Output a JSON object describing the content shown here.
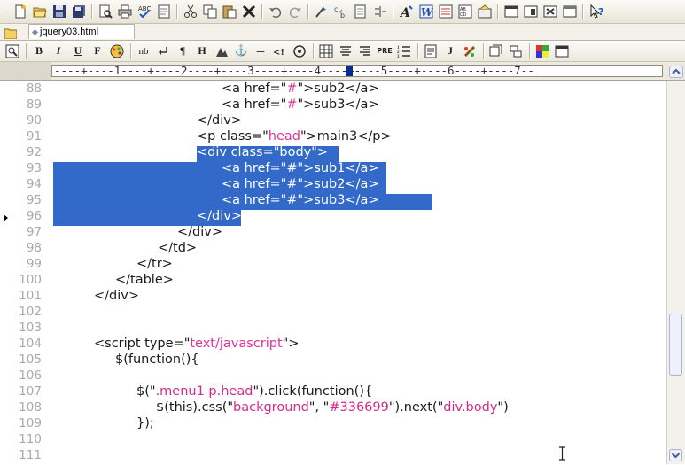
{
  "toolbar": {
    "buttons": [
      "new-file",
      "open-folder",
      "save",
      "save-all",
      "print-preview",
      "print",
      "spell-check",
      "page-setup",
      "cut",
      "copy",
      "paste",
      "delete",
      "undo",
      "redo",
      "find",
      "replace",
      "goto",
      "indent",
      "font",
      "html-wizard",
      "list",
      "insert-table",
      "settings",
      "view-normal",
      "view-split",
      "view-preview",
      "view-full",
      "help"
    ]
  },
  "tab": {
    "title": "jquery03.html"
  },
  "format_toolbar": {
    "buttons": [
      "B",
      "I",
      "U",
      "F",
      "nb",
      "¶",
      "H",
      "⚓",
      "═",
      "PRE",
      "J"
    ]
  },
  "ruler": {
    "text": "----+----1----+----2----+----3----+----4----+----5----+----6----+----7--"
  },
  "editor": {
    "line_numbers": [
      "88",
      "89",
      "90",
      "91",
      "92",
      "93",
      "94",
      "95",
      "96",
      "97",
      "98",
      "99",
      "100",
      "101",
      "102",
      "103",
      "104",
      "105",
      "106",
      "107",
      "108",
      "109",
      "110",
      "111"
    ],
    "lines": {
      "l88": {
        "a": "<a href=\"",
        "v": "#",
        "b": "\">sub2</a>"
      },
      "l89": {
        "a": "<a href=\"",
        "v": "#",
        "b": "\">sub3</a>"
      },
      "l90": {
        "t": "</div>"
      },
      "l91": {
        "a": "<p class=\"",
        "v": "head",
        "b": "\">main3</p>"
      },
      "l92": {
        "t": "<div class=\"body\">"
      },
      "l93": {
        "t": "<a href=\"#\">sub1</a>"
      },
      "l94": {
        "t": "<a href=\"#\">sub2</a>"
      },
      "l95": {
        "t": "<a href=\"#\">sub3</a>"
      },
      "l96": {
        "t": "</div>"
      },
      "l97": {
        "t": "</div>"
      },
      "l98": {
        "t": "</td>"
      },
      "l99": {
        "t": "</tr>"
      },
      "l100": {
        "t": "</table>"
      },
      "l101": {
        "t": "</div>"
      },
      "l104": {
        "a": "<script type=\"",
        "v": "text/javascript",
        "b": "\">"
      },
      "l105": {
        "t": "$(function(){"
      },
      "l107": {
        "a": "$(\"",
        "v": ".menu1 p.head",
        "b": "\").click(function(){"
      },
      "l108": {
        "a": "$(this).css(\"",
        "v": "background",
        "m": "\", \"",
        "v2": "#336699",
        "m2": "\").next(\"",
        "v3": "div.body",
        "b": "\")"
      },
      "l109": {
        "t": "});"
      }
    }
  },
  "colors": {
    "selection": "#3369c8",
    "attribute_value": "#e0309a",
    "line_number": "#a9a9a9"
  }
}
